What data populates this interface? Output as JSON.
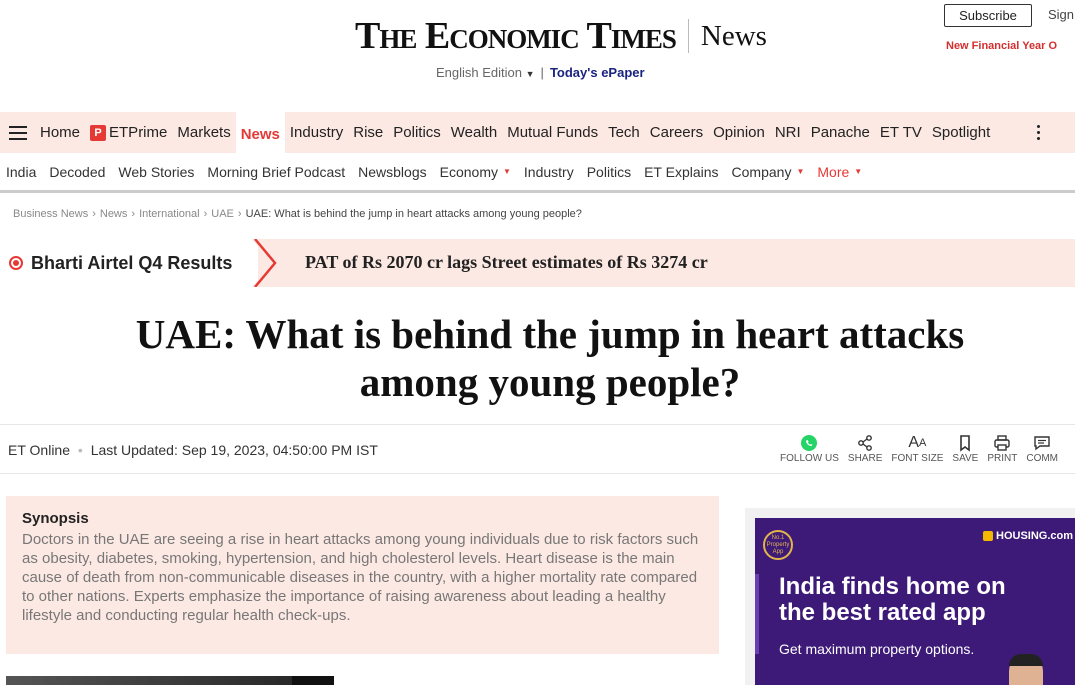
{
  "header": {
    "logo_text": "The Economic Times",
    "section": "News",
    "edition": "English Edition",
    "edition_separator": "|",
    "epaper": "Today's ePaper",
    "subscribe": "Subscribe",
    "signin": "Sign",
    "promo": "New Financial Year O"
  },
  "primary_nav": {
    "items": [
      "Home",
      "ETPrime",
      "Markets",
      "News",
      "Industry",
      "Rise",
      "Politics",
      "Wealth",
      "Mutual Funds",
      "Tech",
      "Careers",
      "Opinion",
      "NRI",
      "Panache",
      "ET TV",
      "Spotlight"
    ],
    "active": "News"
  },
  "secondary_nav": {
    "items": [
      "India",
      "Decoded",
      "Web Stories",
      "Morning Brief Podcast",
      "Newsblogs",
      "Economy",
      "Industry",
      "Politics",
      "ET Explains",
      "Company",
      "More"
    ]
  },
  "breadcrumb": {
    "items": [
      "Business News",
      "News",
      "International",
      "UAE"
    ],
    "current": "UAE: What is behind the jump in heart attacks among young people?"
  },
  "ticker": {
    "label": "Bharti Airtel Q4 Results",
    "text": "PAT of Rs 2070 cr lags Street estimates of Rs 3274 cr"
  },
  "article": {
    "headline": "UAE: What is behind the jump in heart attacks among young people?",
    "author": "ET Online",
    "updated": "Last Updated: Sep 19, 2023, 04:50:00 PM IST"
  },
  "actions": {
    "follow": "FOLLOW US",
    "share": "SHARE",
    "font_size": "FONT SIZE",
    "save": "SAVE",
    "print": "PRINT",
    "comment": "COMM"
  },
  "synopsis": {
    "title": "Synopsis",
    "body": "Doctors in the UAE are seeing a rise in heart attacks among young individuals due to risk factors such as obesity, diabetes, smoking, hypertension, and high cholesterol levels. Heart disease is the main cause of death from non-communicable diseases in the country, with a higher mortality rate compared to other nations. Experts emphasize the importance of raising awareness about leading a healthy lifestyle and conducting regular health check-ups."
  },
  "ad": {
    "badge": "No.1 Property App",
    "brand": "HOUSING.com",
    "headline_line1": "India finds home on",
    "headline_line2": "the best rated app",
    "sub": "Get maximum property options."
  },
  "colors": {
    "accent": "#e53935",
    "nav_bg": "#fde9e3",
    "ad_bg": "#3d1a78"
  }
}
